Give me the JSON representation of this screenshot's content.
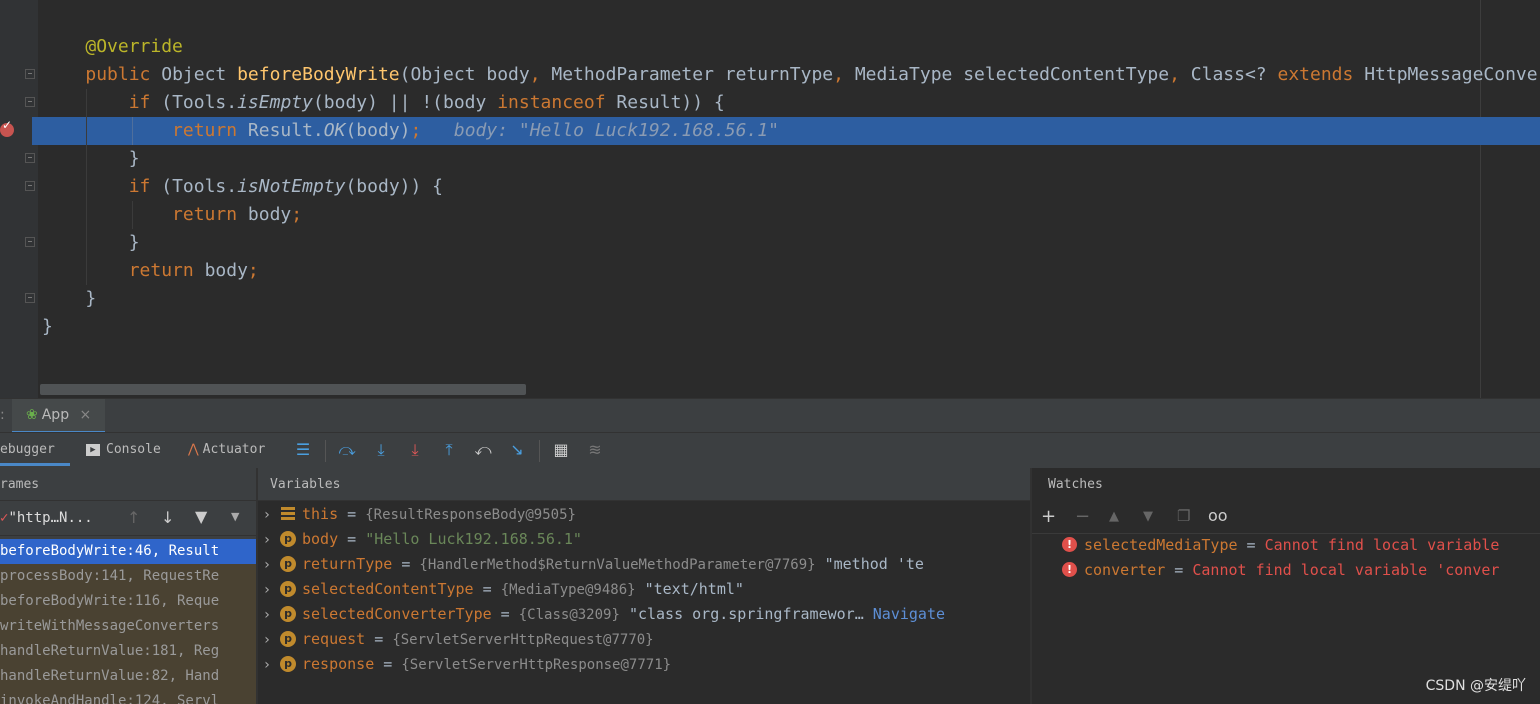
{
  "editor": {
    "hint": "body: \"Hello Luck192.168.56.1\""
  },
  "run_tab": {
    "label": "App",
    "close": "×"
  },
  "toolbar": {
    "debugger_label": "ebugger",
    "console_label": "Console",
    "actuator_label": "Actuator"
  },
  "panels": {
    "frames_title": "rames",
    "variables_title": "Variables",
    "watches_title": "Watches"
  },
  "frames": {
    "thread_label": "\"http…N...",
    "items": [
      "beforeBodyWrite:46, Result",
      "processBody:141, RequestRe",
      "beforeBodyWrite:116, Reque",
      "writeWithMessageConverters",
      "handleReturnValue:181, Reg",
      "handleReturnValue:82, Hand",
      "invokeAndHandle:124, Servl"
    ]
  },
  "variables": [
    {
      "kind": "field",
      "name": "this",
      "ref": "{ResultResponseBody@9505}",
      "value": "",
      "link": ""
    },
    {
      "kind": "p",
      "name": "body",
      "ref": "",
      "value": "\"Hello Luck192.168.56.1\"",
      "link": ""
    },
    {
      "kind": "p",
      "name": "returnType",
      "ref": "{HandlerMethod$ReturnValueMethodParameter@7769}",
      "value": "\"method 'te",
      "link": ""
    },
    {
      "kind": "p",
      "name": "selectedContentType",
      "ref": "{MediaType@9486}",
      "value": "\"text/html\"",
      "link": ""
    },
    {
      "kind": "p",
      "name": "selectedConverterType",
      "ref": "{Class@3209}",
      "value": "\"class org.springframewor…",
      "link": "Navigate"
    },
    {
      "kind": "p",
      "name": "request",
      "ref": "{ServletServerHttpRequest@7770}",
      "value": "",
      "link": ""
    },
    {
      "kind": "p",
      "name": "response",
      "ref": "{ServletServerHttpResponse@7771}",
      "value": "",
      "link": ""
    }
  ],
  "watches": [
    {
      "name": "selectedMediaType",
      "error": "Cannot find local variable"
    },
    {
      "name": "converter",
      "error": "Cannot find local variable 'conver"
    }
  ],
  "watermark": "CSDN @安缇吖",
  "colors": {
    "keyword": "#cc7832",
    "method": "#ffc66d",
    "annotation": "#bbb529",
    "string": "#6a8759",
    "execution_line": "#2d5ea1",
    "error": "#e0504b"
  }
}
